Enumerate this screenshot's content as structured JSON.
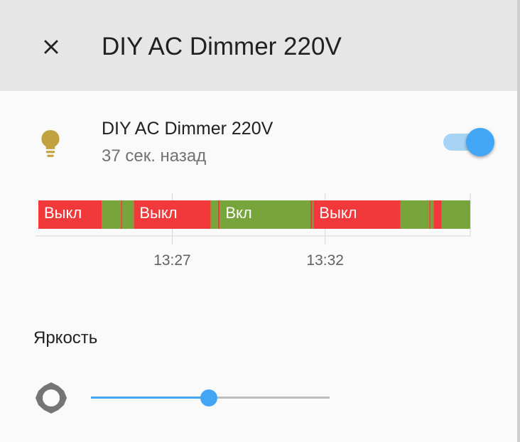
{
  "dialog": {
    "title": "DIY AC Dimmer 220V",
    "close_icon": "close-icon"
  },
  "entity": {
    "icon": "lightbulb-icon",
    "icon_color": "#c1a23e",
    "name": "DIY AC Dimmer 220V",
    "last_changed": "37 сек. назад",
    "state_on": true,
    "toggle_color": "#42a5f5"
  },
  "history": {
    "colors": {
      "off": "#f1383a",
      "on": "#77a53c"
    },
    "segments": [
      {
        "state": "off",
        "start": 0.0,
        "end": 0.147
      },
      {
        "state": "on",
        "start": 0.147,
        "end": 0.191
      },
      {
        "state": "off",
        "start": 0.191,
        "end": 0.194
      },
      {
        "state": "on",
        "start": 0.194,
        "end": 0.221
      },
      {
        "state": "off",
        "start": 0.221,
        "end": 0.399
      },
      {
        "state": "on",
        "start": 0.399,
        "end": 0.416
      },
      {
        "state": "off",
        "start": 0.416,
        "end": 0.42
      },
      {
        "state": "on",
        "start": 0.42,
        "end": 0.63
      },
      {
        "state": "off",
        "start": 0.63,
        "end": 0.634
      },
      {
        "state": "on",
        "start": 0.634,
        "end": 0.637
      },
      {
        "state": "off",
        "start": 0.637,
        "end": 0.838
      },
      {
        "state": "on",
        "start": 0.838,
        "end": 0.905
      },
      {
        "state": "off",
        "start": 0.905,
        "end": 0.908
      },
      {
        "state": "on",
        "start": 0.908,
        "end": 0.915
      },
      {
        "state": "off",
        "start": 0.915,
        "end": 0.934
      },
      {
        "state": "on",
        "start": 0.934,
        "end": 1.0
      }
    ],
    "labels": [
      {
        "text": "Выкл",
        "at": 0.0
      },
      {
        "text": "Выкл",
        "at": 0.221
      },
      {
        "text": "Вкл",
        "at": 0.42
      },
      {
        "text": "Выкл",
        "at": 0.637
      }
    ],
    "ticks": [
      {
        "label": "13:27",
        "at": 0.31
      },
      {
        "label": "13:32",
        "at": 0.664
      }
    ]
  },
  "brightness": {
    "label": "Яркость",
    "icon": "brightness-icon",
    "value_fraction": 0.495
  }
}
